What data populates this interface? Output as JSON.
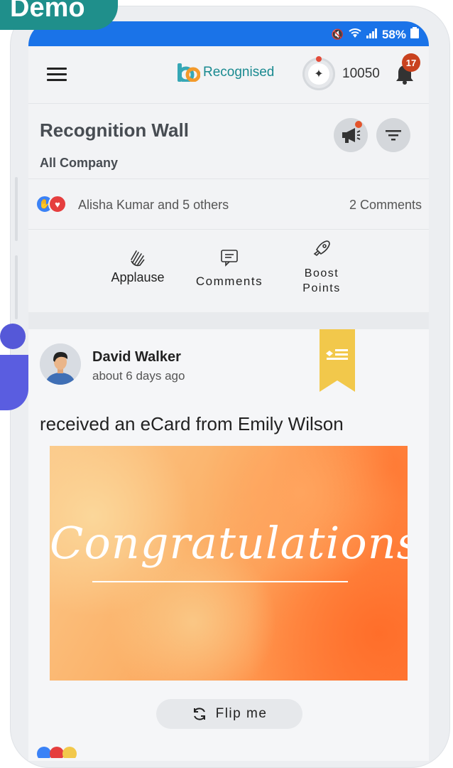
{
  "badge": {
    "label": "Demo"
  },
  "status_bar": {
    "battery": "58%"
  },
  "app_bar": {
    "logo_text": "Recognised",
    "points": "10050",
    "notification_count": "17"
  },
  "wall": {
    "title": "Recognition Wall",
    "filter": "All Company"
  },
  "reactions": {
    "summary": "Alisha Kumar and 5 others",
    "comments": "2 Comments"
  },
  "actions": {
    "applause": "Applause",
    "comments": "Comments",
    "boost_line1": "Boost",
    "boost_line2": "Points"
  },
  "post": {
    "author": "David Walker",
    "time": "about 6 days ago",
    "text": "received an eCard from Emily Wilson",
    "ecard_text": "Congratulations",
    "flip_label": "Flip me"
  },
  "colors": {
    "status_bar": "#1a73e8",
    "brand_teal": "#1a8a90",
    "badge_teal": "#1f8f8b",
    "ribbon": "#f2c84b",
    "notif_badge": "#c9421f"
  }
}
